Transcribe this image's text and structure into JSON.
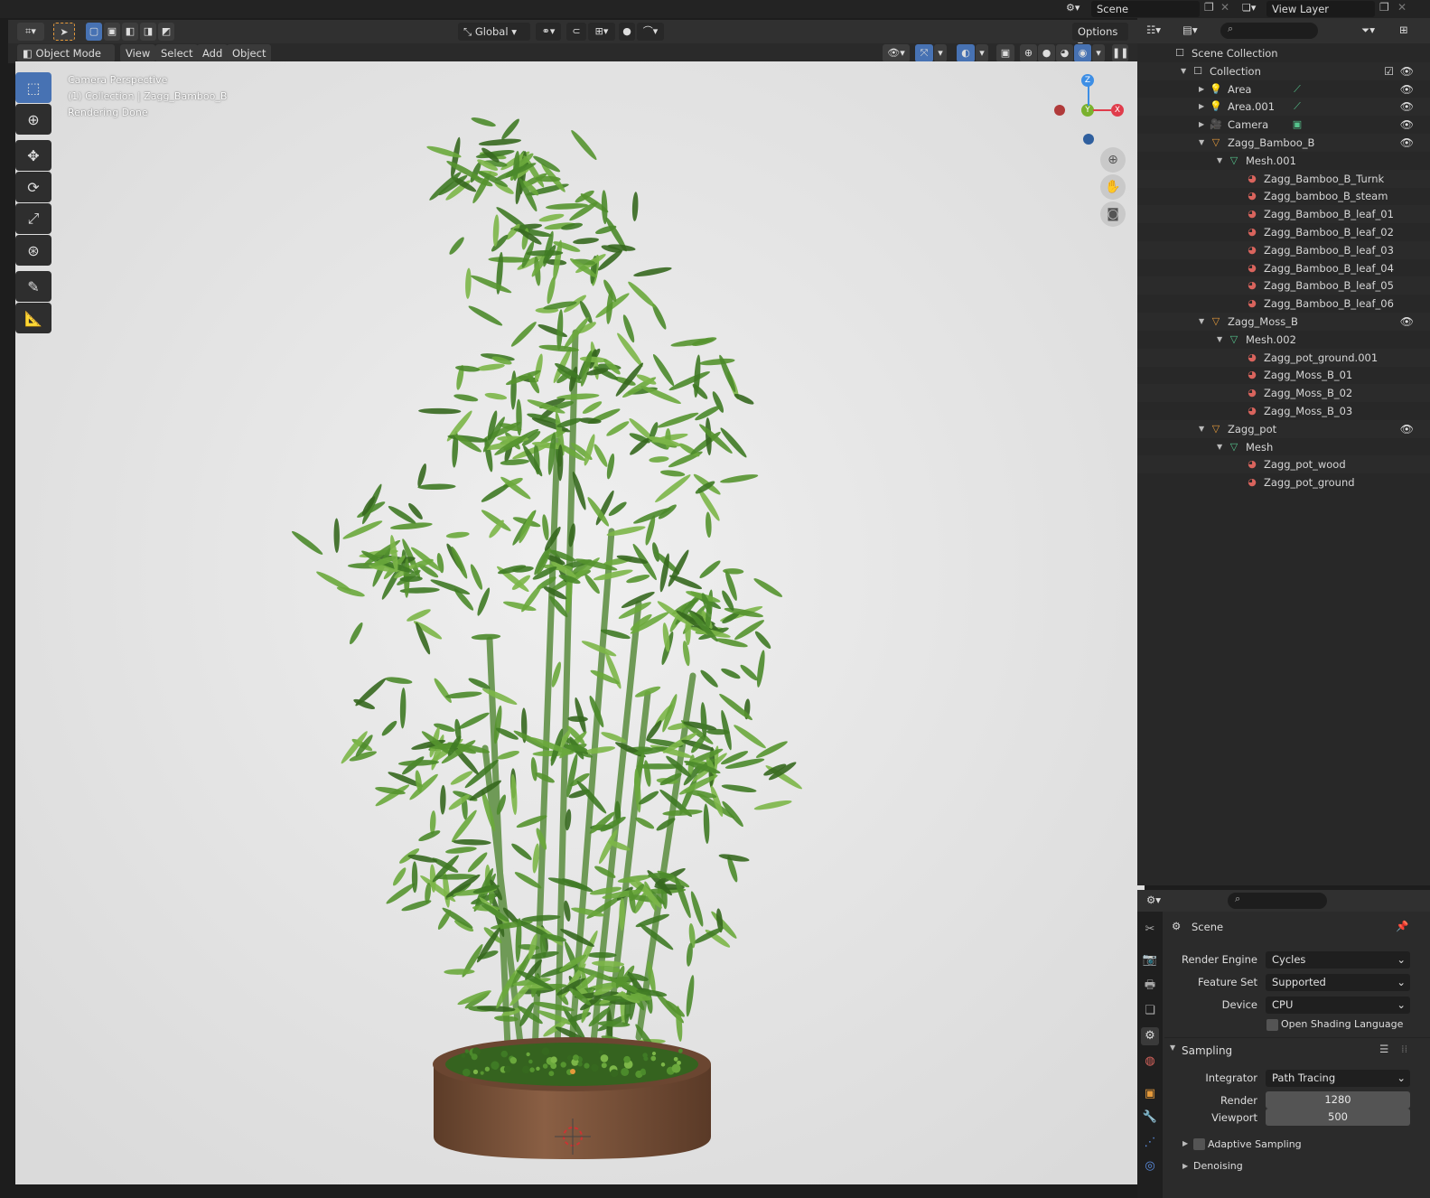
{
  "topbar": {
    "scene_label": "Scene",
    "view_layer_label": "View Layer"
  },
  "viewport_header": {
    "orientation": "Global",
    "options": "Options",
    "mode": "Object Mode",
    "menu": [
      "View",
      "Select",
      "Add",
      "Object"
    ]
  },
  "viewport": {
    "overlay_line1": "Camera Perspective",
    "overlay_line2": "(1) Collection | Zagg_Bamboo_B",
    "overlay_line3": "Rendering Done",
    "gizmo": {
      "z": "Z",
      "y": "Y",
      "x": "X"
    }
  },
  "outliner": {
    "rows": [
      {
        "label": "Scene Collection",
        "depth": 0,
        "icon": "scene-collection-icon",
        "tri": "",
        "eye": false
      },
      {
        "label": "Collection",
        "depth": 1,
        "icon": "collection-icon",
        "tri": "▼",
        "eye": true,
        "check": true
      },
      {
        "label": "Area",
        "depth": 2,
        "icon": "light-icon",
        "tri": "▶",
        "eye": true,
        "extra": "light-data-icon"
      },
      {
        "label": "Area.001",
        "depth": 2,
        "icon": "light-icon",
        "tri": "▶",
        "eye": true,
        "extra": "light-data-icon"
      },
      {
        "label": "Camera",
        "depth": 2,
        "icon": "camera-icon",
        "tri": "▶",
        "eye": true,
        "extra": "camera-data-icon"
      },
      {
        "label": "Zagg_Bamboo_B",
        "depth": 2,
        "icon": "mesh-object-icon",
        "tri": "▼",
        "eye": true
      },
      {
        "label": "Mesh.001",
        "depth": 3,
        "icon": "mesh-data-icon",
        "tri": "▼",
        "eye": false
      },
      {
        "label": "Zagg_Bamboo_B_Turnk",
        "depth": 4,
        "icon": "material-icon",
        "tri": "",
        "eye": false
      },
      {
        "label": "Zagg_bamboo_B_steam",
        "depth": 4,
        "icon": "material-icon",
        "tri": "",
        "eye": false
      },
      {
        "label": "Zagg_Bamboo_B_leaf_01",
        "depth": 4,
        "icon": "material-icon",
        "tri": "",
        "eye": false
      },
      {
        "label": "Zagg_Bamboo_B_leaf_02",
        "depth": 4,
        "icon": "material-icon",
        "tri": "",
        "eye": false
      },
      {
        "label": "Zagg_Bamboo_B_leaf_03",
        "depth": 4,
        "icon": "material-icon",
        "tri": "",
        "eye": false
      },
      {
        "label": "Zagg_Bamboo_B_leaf_04",
        "depth": 4,
        "icon": "material-icon",
        "tri": "",
        "eye": false
      },
      {
        "label": "Zagg_Bamboo_B_leaf_05",
        "depth": 4,
        "icon": "material-icon",
        "tri": "",
        "eye": false
      },
      {
        "label": "Zagg_Bamboo_B_leaf_06",
        "depth": 4,
        "icon": "material-icon",
        "tri": "",
        "eye": false
      },
      {
        "label": "Zagg_Moss_B",
        "depth": 2,
        "icon": "mesh-object-icon",
        "tri": "▼",
        "eye": true
      },
      {
        "label": "Mesh.002",
        "depth": 3,
        "icon": "mesh-data-icon",
        "tri": "▼",
        "eye": false
      },
      {
        "label": "Zagg_pot_ground.001",
        "depth": 4,
        "icon": "material-icon",
        "tri": "",
        "eye": false
      },
      {
        "label": "Zagg_Moss_B_01",
        "depth": 4,
        "icon": "material-icon",
        "tri": "",
        "eye": false
      },
      {
        "label": "Zagg_Moss_B_02",
        "depth": 4,
        "icon": "material-icon",
        "tri": "",
        "eye": false
      },
      {
        "label": "Zagg_Moss_B_03",
        "depth": 4,
        "icon": "material-icon",
        "tri": "",
        "eye": false
      },
      {
        "label": "Zagg_pot",
        "depth": 2,
        "icon": "mesh-object-icon",
        "tri": "▼",
        "eye": true
      },
      {
        "label": "Mesh",
        "depth": 3,
        "icon": "mesh-data-icon",
        "tri": "▼",
        "eye": false
      },
      {
        "label": "Zagg_pot_wood",
        "depth": 4,
        "icon": "material-icon",
        "tri": "",
        "eye": false
      },
      {
        "label": "Zagg_pot_ground",
        "depth": 4,
        "icon": "material-icon",
        "tri": "",
        "eye": false
      }
    ]
  },
  "properties": {
    "context": "Scene",
    "render_engine_label": "Render Engine",
    "render_engine": "Cycles",
    "feature_set_label": "Feature Set",
    "feature_set": "Supported",
    "device_label": "Device",
    "device": "CPU",
    "osl_label": "Open Shading Language",
    "sampling_label": "Sampling",
    "integrator_label": "Integrator",
    "integrator": "Path Tracing",
    "render_label": "Render",
    "render_samples": "1280",
    "viewport_label": "Viewport",
    "viewport_samples": "500",
    "adaptive_label": "Adaptive Sampling",
    "denoising_label": "Denoising"
  },
  "colors": {
    "accent": "#4772b3",
    "object_orange": "#e59a3b",
    "mesh_green": "#55c38c",
    "material_red": "#d9645d",
    "gizmo_x": "#e03c4b",
    "gizmo_y": "#7ab12e",
    "gizmo_z": "#3d8ee5",
    "leaf_green": "#4e8a2c",
    "pot_wood": "#7a5238"
  }
}
